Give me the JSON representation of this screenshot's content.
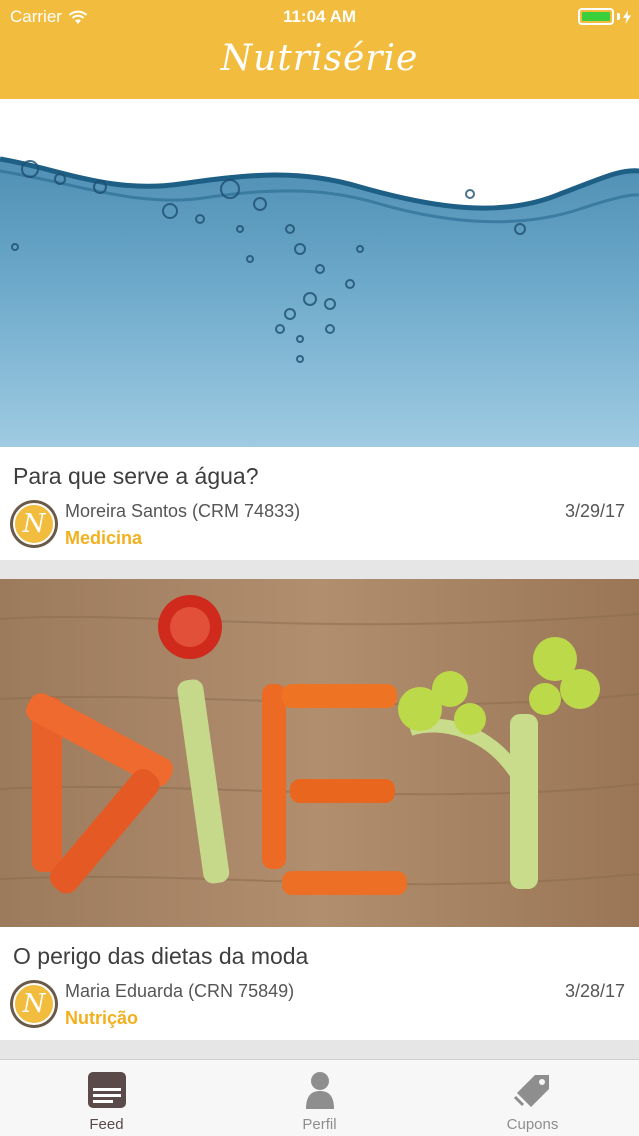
{
  "status_bar": {
    "carrier": "Carrier",
    "time": "11:04 AM"
  },
  "nav": {
    "title": "Nutrisérie"
  },
  "feed": {
    "posts": [
      {
        "title": "Para que serve a água?",
        "author": "Moreira Santos (CRM 74833)",
        "category": "Medicina",
        "date": "3/29/17",
        "avatar_letter": "N"
      },
      {
        "title": "O perigo das dietas da moda",
        "author": "Maria Eduarda (CRN 75849)",
        "category": "Nutrição",
        "date": "3/28/17",
        "avatar_letter": "N"
      }
    ]
  },
  "tabs": [
    {
      "label": "Feed",
      "icon": "feed-icon",
      "active": true
    },
    {
      "label": "Perfil",
      "icon": "profile-icon",
      "active": false
    },
    {
      "label": "Cupons",
      "icon": "tag-icon",
      "active": false
    }
  ],
  "colors": {
    "accent": "#f2bd3e",
    "category": "#f2b01e"
  }
}
